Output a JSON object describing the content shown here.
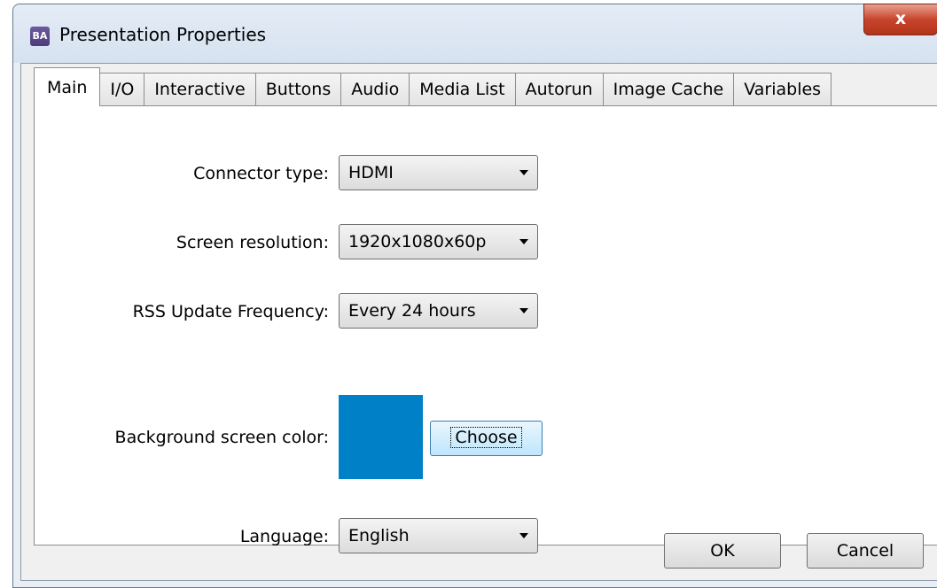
{
  "window": {
    "title": "Presentation Properties",
    "app_icon_text": "BA",
    "close_glyph": "x"
  },
  "tabs": [
    {
      "label": "Main",
      "active": true
    },
    {
      "label": "I/O"
    },
    {
      "label": "Interactive"
    },
    {
      "label": "Buttons"
    },
    {
      "label": "Audio"
    },
    {
      "label": "Media List"
    },
    {
      "label": "Autorun"
    },
    {
      "label": "Image Cache"
    },
    {
      "label": "Variables"
    }
  ],
  "main": {
    "connector_type": {
      "label": "Connector type:",
      "value": "HDMI"
    },
    "screen_resolution": {
      "label": "Screen resolution:",
      "value": "1920x1080x60p"
    },
    "rss_update_frequency": {
      "label": "RSS Update Frequency:",
      "value": "Every 24 hours"
    },
    "background_color": {
      "label": "Background screen color:",
      "color": "#0080c6",
      "choose_label": "Choose"
    },
    "language": {
      "label": "Language:",
      "value": "English"
    }
  },
  "footer": {
    "ok_label": "OK",
    "cancel_label": "Cancel"
  }
}
